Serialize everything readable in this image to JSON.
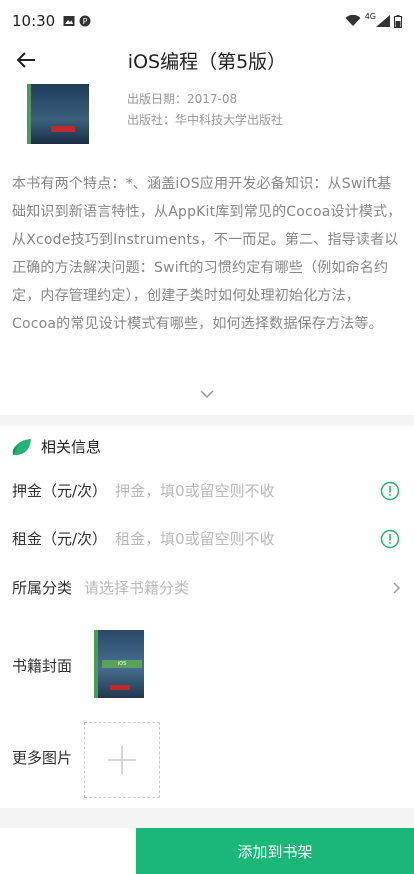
{
  "status_bar": {
    "time": "10:30",
    "network": "4G"
  },
  "header": {
    "title": "iOS编程（第5版）"
  },
  "book": {
    "publish_date": "出版日期：2017-08",
    "publisher": "出版社：华中科技大学出版社",
    "description": "本书有两个特点：*、涵盖iOS应用开发必备知识：从Swift基础知识到新语言特性，从AppKit库到常见的Cocoa设计模式，从Xcode技巧到Instruments，不一而足。第二、指导读者以正确的方法解决问题：Swift的习惯约定有哪些（例如命名约定，内存管理约定），创建子类时如何处理初始化方法，Cocoa的常见设计模式有哪些，如何选择数据保存方法等。"
  },
  "related": {
    "section_title": "相关信息",
    "deposit": {
      "label": "押金（元/次）",
      "placeholder": "押金，填0或留空则不收"
    },
    "rent": {
      "label": "租金（元/次）",
      "placeholder": "租金，填0或留空则不收"
    },
    "category": {
      "label": "所属分类",
      "placeholder": "请选择书籍分类"
    },
    "cover_label": "书籍封面",
    "more_images_label": "更多图片"
  },
  "actions": {
    "add_to_shelf": "添加到书架"
  },
  "colors": {
    "accent": "#1bb67a",
    "leaf": "#22b573"
  }
}
